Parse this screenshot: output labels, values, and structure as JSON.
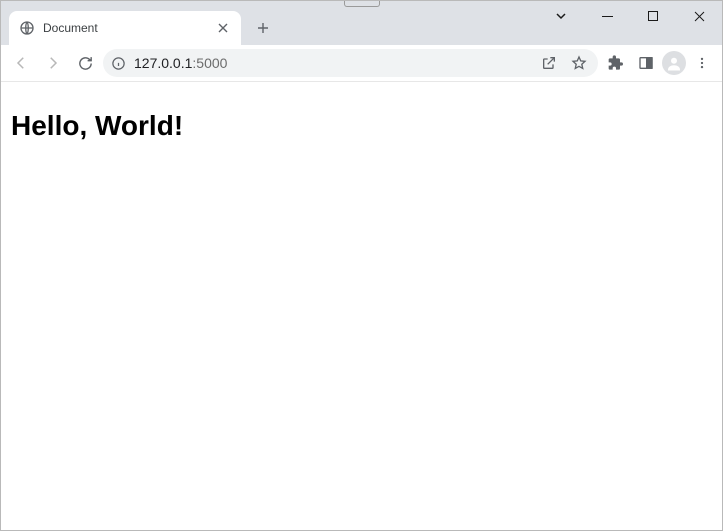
{
  "tab": {
    "title": "Document"
  },
  "address": {
    "host": "127.0.0.1",
    "port": ":5000"
  },
  "page": {
    "heading": "Hello, World!"
  }
}
